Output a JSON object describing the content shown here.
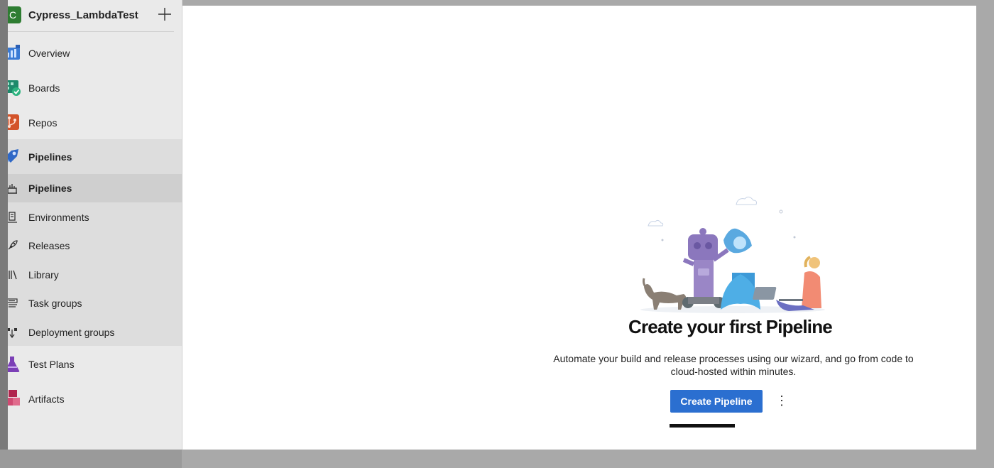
{
  "project": {
    "initial": "C",
    "name": "Cypress_LambdaTest",
    "badge_color": "#2e7d32"
  },
  "nav": [
    {
      "label": "Overview",
      "icon": "overview-icon"
    },
    {
      "label": "Boards",
      "icon": "boards-icon"
    },
    {
      "label": "Repos",
      "icon": "repos-icon"
    },
    {
      "label": "Pipelines",
      "icon": "pipelines-icon"
    },
    {
      "label": "Test Plans",
      "icon": "test-plans-icon"
    },
    {
      "label": "Artifacts",
      "icon": "artifacts-icon"
    }
  ],
  "pipelines_sub": [
    {
      "label": "Pipelines",
      "icon": "pipelines-sub-icon",
      "active": true
    },
    {
      "label": "Environments",
      "icon": "environments-icon"
    },
    {
      "label": "Releases",
      "icon": "releases-icon"
    },
    {
      "label": "Library",
      "icon": "library-icon"
    },
    {
      "label": "Task groups",
      "icon": "task-groups-icon"
    },
    {
      "label": "Deployment groups",
      "icon": "deployment-groups-icon"
    }
  ],
  "empty_state": {
    "title": "Create your first Pipeline",
    "description": "Automate your build and release processes using our wizard, and go from code to cloud-hosted within minutes.",
    "primary_button": "Create Pipeline",
    "more_button": "⋮"
  },
  "colors": {
    "accent": "#2b6fd0",
    "sidebar_bg": "#eaeaea",
    "group_bg": "#dddddd",
    "active_bg": "#cfcfcf"
  }
}
